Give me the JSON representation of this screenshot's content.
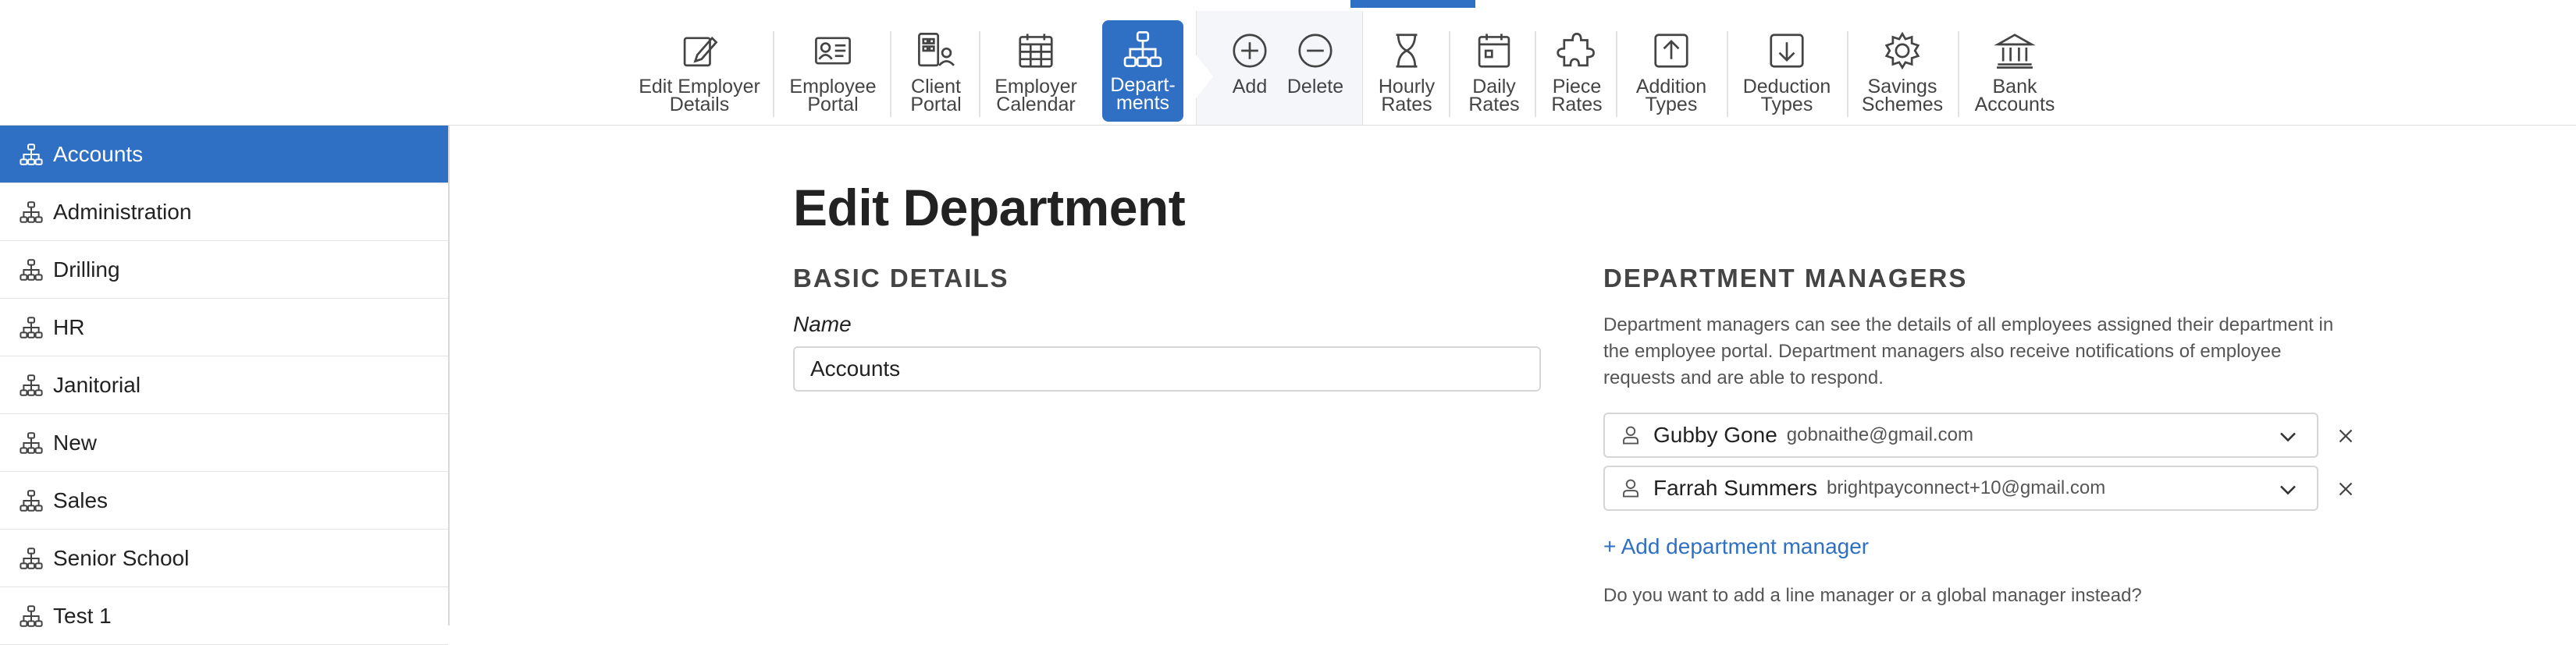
{
  "toolbar": {
    "items": [
      {
        "label": "Edit Employer\nDetails",
        "icon": "edit-icon"
      },
      {
        "label": "Employee\nPortal",
        "icon": "id-card-icon"
      },
      {
        "label": "Client\nPortal",
        "icon": "client-icon"
      },
      {
        "label": "Employer\nCalendar",
        "icon": "calendar-icon"
      },
      {
        "label": "Depart-\nments",
        "icon": "org-chart-icon"
      },
      {
        "label": "Add",
        "icon": "plus-circle-icon"
      },
      {
        "label": "Delete",
        "icon": "minus-circle-icon"
      },
      {
        "label": "Hourly\nRates",
        "icon": "hourglass-icon"
      },
      {
        "label": "Daily\nRates",
        "icon": "daily-calendar-icon"
      },
      {
        "label": "Piece\nRates",
        "icon": "puzzle-icon"
      },
      {
        "label": "Addition\nTypes",
        "icon": "upload-icon"
      },
      {
        "label": "Deduction\nTypes",
        "icon": "download-icon"
      },
      {
        "label": "Savings\nSchemes",
        "icon": "gear-icon"
      },
      {
        "label": "Bank\nAccounts",
        "icon": "bank-icon"
      }
    ]
  },
  "sidebar": {
    "items": [
      {
        "label": "Accounts",
        "active": true
      },
      {
        "label": "Administration"
      },
      {
        "label": "Drilling"
      },
      {
        "label": "HR"
      },
      {
        "label": "Janitorial"
      },
      {
        "label": "New"
      },
      {
        "label": "Sales"
      },
      {
        "label": "Senior School"
      },
      {
        "label": "Test 1"
      }
    ]
  },
  "main": {
    "title": "Edit Department",
    "basic_details_title": "BASIC DETAILS",
    "name_label": "Name",
    "name_value": "Accounts",
    "managers_title": "DEPARTMENT MANAGERS",
    "managers_description": "Department managers can see the details of all employees assigned their department in the employee portal. Department managers also receive notifications of employee requests and are able to respond.",
    "managers": [
      {
        "name": "Gubby Gone",
        "email": "gobnaithe@gmail.com"
      },
      {
        "name": "Farrah Summers",
        "email": "brightpayconnect+10@gmail.com"
      }
    ],
    "add_manager_label": "+ Add department manager",
    "bottom_question": "Do you want to add a line manager or a global manager instead?"
  },
  "colors": {
    "accent": "#2f6fc4"
  }
}
